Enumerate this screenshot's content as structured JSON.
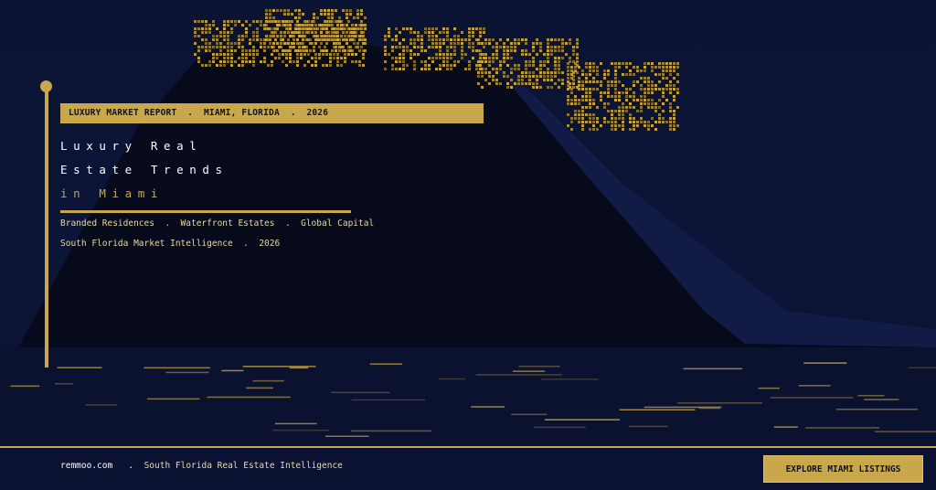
{
  "header": {
    "tag": "LUXURY MARKET REPORT  .  MIAMI, FLORIDA  .  2026"
  },
  "title": {
    "line1": "Luxury Real",
    "line2": "Estate Trends",
    "line3": "in Miami"
  },
  "subtitle": {
    "line1": "Branded Residences  .  Waterfront Estates  .  Global Capital",
    "line2": "South Florida Market Intelligence  .  2026"
  },
  "footer": {
    "site": "remmoo.com",
    "separator": ".",
    "tagline": "South Florida Real Estate Intelligence",
    "cta_label": "EXPLORE MIAMI LISTINGS"
  },
  "colors": {
    "background": "#0b1333",
    "accent_gold": "#c9a84c",
    "text_light": "#e9d9a7",
    "mountain": "#060a1a"
  }
}
